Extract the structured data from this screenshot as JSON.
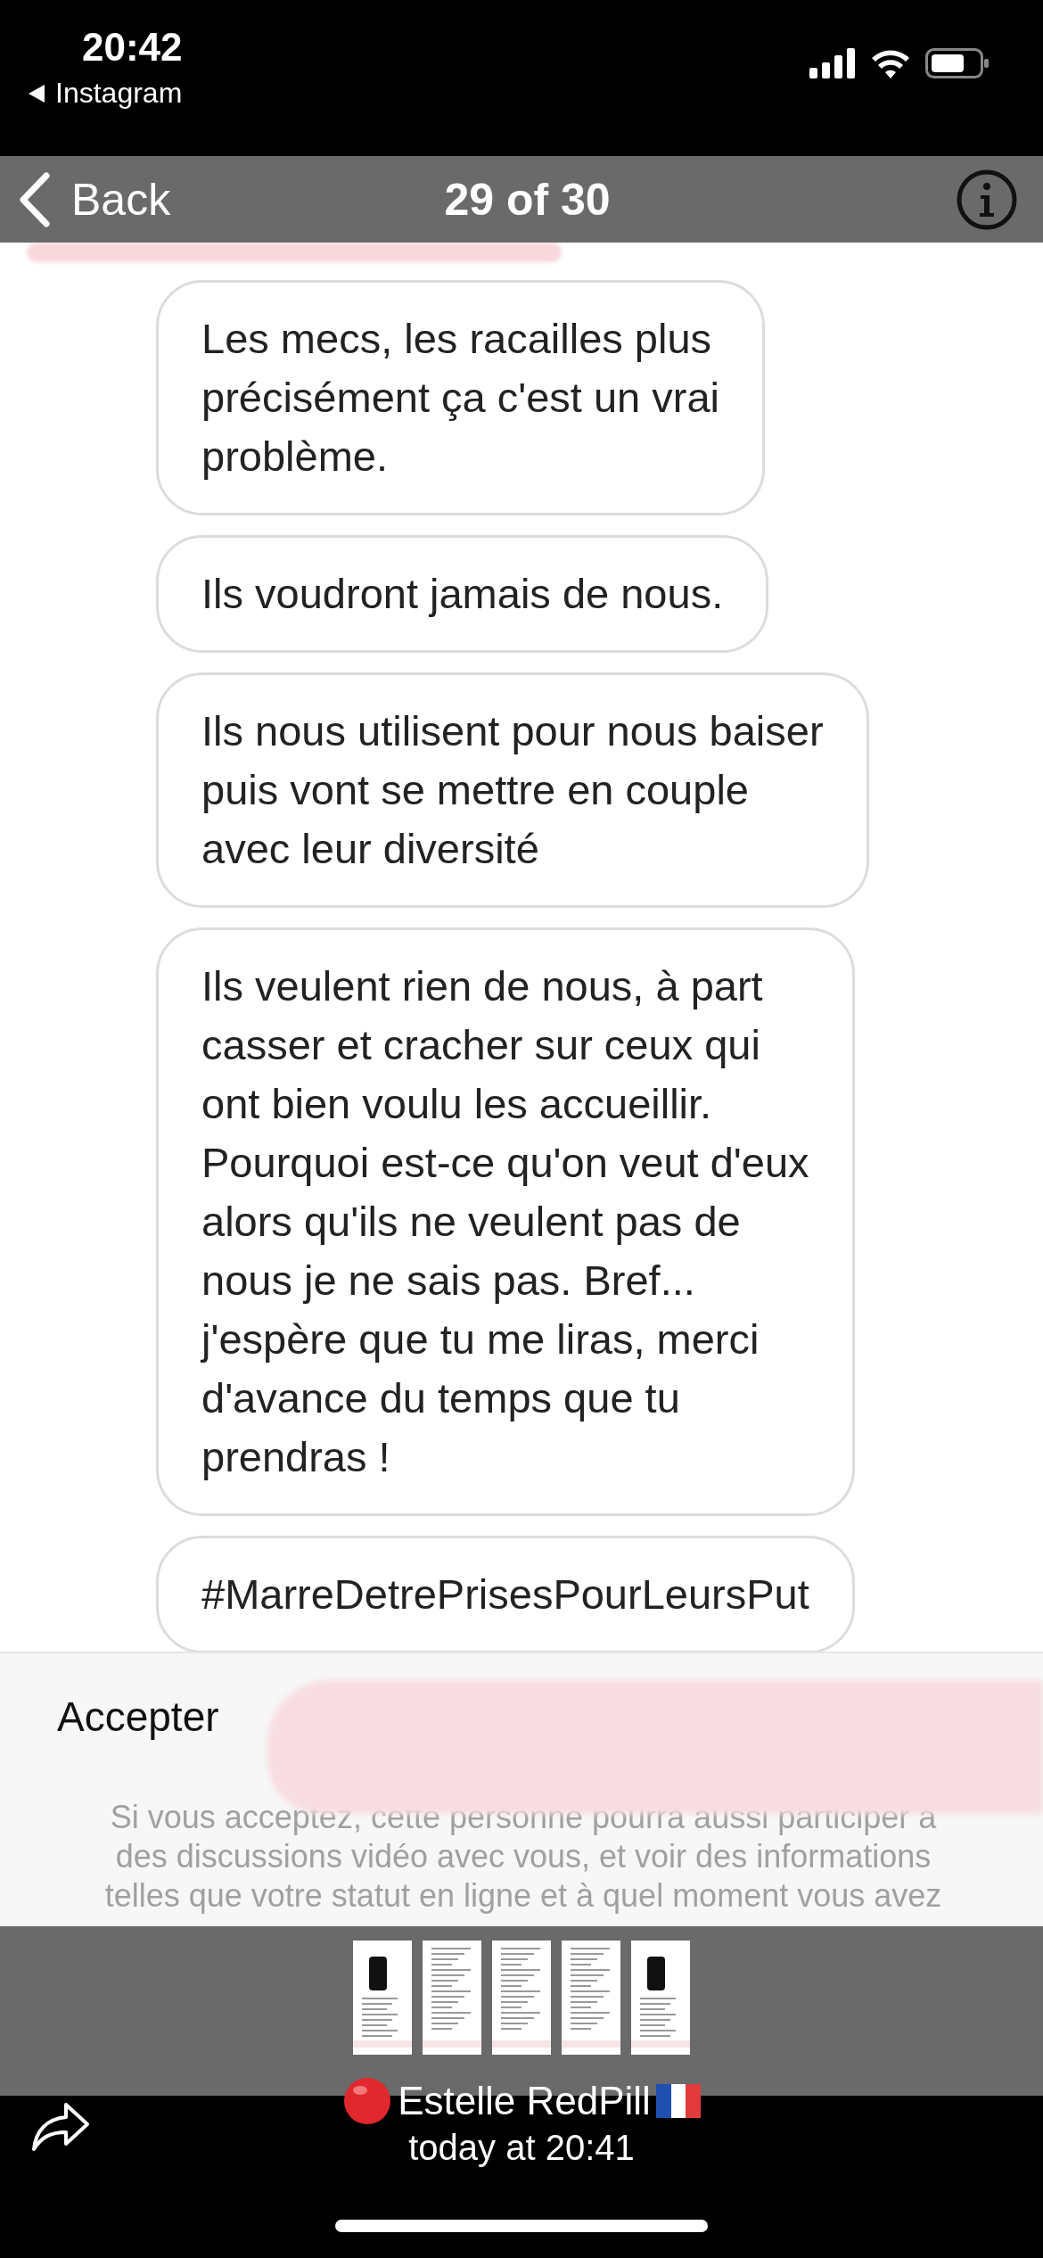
{
  "status_bar": {
    "time": "20:42",
    "back_app": "Instagram"
  },
  "nav_bar": {
    "back": "Back",
    "title": "29 of 30"
  },
  "messages": [
    {
      "text": "Les mecs, les racailles plus\nprécisément ça c'est un vrai\nproblème."
    },
    {
      "text": "Ils voudront jamais de nous."
    },
    {
      "text": "Ils nous utilisent pour nous baiser\npuis vont se mettre en  couple\navec leur diversité"
    },
    {
      "text": "Ils veulent rien de nous, à part\ncasser et cracher sur ceux qui\nont bien voulu les accueillir.\nPourquoi est-ce qu'on veut d'eux\nalors qu'ils ne veulent pas de\nnous je ne sais pas. Bref...\nj'espère que tu me liras, merci\nd'avance du temps que tu\nprendras !"
    },
    {
      "text": "#MarreDetrePrisesPourLeursPut"
    }
  ],
  "request_sheet": {
    "title": "Accepter",
    "body": "Si vous acceptez, cette personne pourra aussi participer à des discussions vidéo avec vous, et voir des informations telles que votre statut en ligne et à quel moment vous avez"
  },
  "thumbnails": [
    {
      "kind": "phone"
    },
    {
      "kind": "text"
    },
    {
      "kind": "text"
    },
    {
      "kind": "text"
    },
    {
      "kind": "phone"
    }
  ],
  "footer": {
    "sender": "Estelle RedPill",
    "time": "today at 20:41"
  }
}
